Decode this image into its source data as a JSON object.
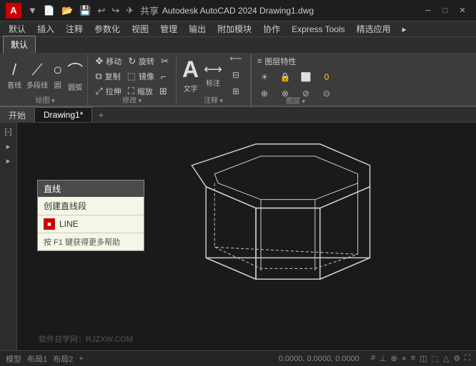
{
  "titlebar": {
    "app_letter": "A",
    "title": "Autodesk AutoCAD 2024    Drawing1.dwg",
    "quick_tools": [
      "▼",
      "📄",
      "📂",
      "💾",
      "↩",
      "↪",
      "✈",
      "共享"
    ],
    "window_controls": [
      "─",
      "□",
      "✕"
    ]
  },
  "menubar": {
    "items": [
      "默认",
      "插入",
      "注释",
      "参数化",
      "视图",
      "管理",
      "输出",
      "附加模块",
      "协作",
      "Express Tools",
      "精选应用",
      "▸"
    ]
  },
  "ribbon": {
    "groups": [
      {
        "name": "draw",
        "label": "直线  多段线  圆  圆弧",
        "tools": [
          "直线",
          "多段线",
          "圆",
          "圆弧"
        ]
      },
      {
        "name": "modify",
        "label": "修改 ▾"
      },
      {
        "name": "annotation",
        "label": "注释 ▾"
      },
      {
        "name": "layers",
        "label": "图层"
      }
    ]
  },
  "tabs": {
    "drawing_tab": "开始",
    "file_tab": "Drawing1*",
    "plus": "+"
  },
  "context_menu": {
    "header": "直线",
    "items": [
      "创建直线段"
    ],
    "command_label": "LINE",
    "footer": "按 F1 键获得更多帮助"
  },
  "drawing": {
    "shape": "hexagonal_box"
  },
  "watermark": "软件自学网：RJZXW.COM",
  "left_toolbar": {
    "items": [
      "[-]",
      "▸",
      "▸",
      "▸"
    ]
  },
  "ribbon_tools": {
    "move": "移动",
    "rotate": "旋转",
    "trim": "✂",
    "copy": "复制",
    "mirror": "镜像",
    "fillet": "⌒",
    "stretch": "拉伸",
    "scale": "缩放",
    "array": "⊞",
    "text_label": "文字",
    "mark_label": "标注",
    "layer_prop": "图层特性"
  }
}
